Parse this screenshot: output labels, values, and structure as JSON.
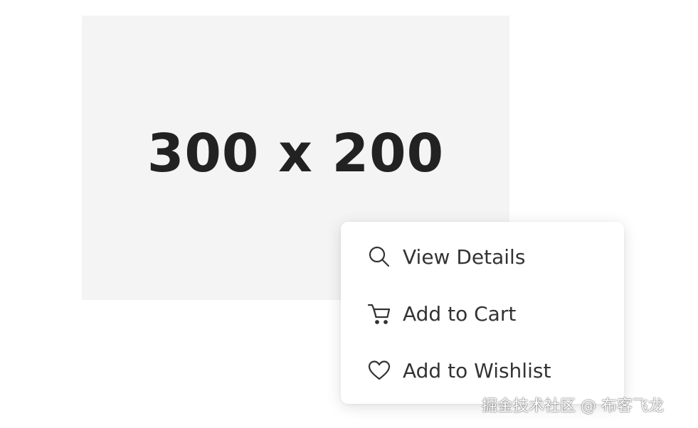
{
  "placeholder": {
    "text": "300 x 200"
  },
  "menu": {
    "items": [
      {
        "icon": "search-icon",
        "label": "View Details"
      },
      {
        "icon": "cart-icon",
        "label": "Add to Cart"
      },
      {
        "icon": "heart-icon",
        "label": "Add to Wishlist"
      }
    ]
  },
  "watermark": {
    "text": "掘金技术社区 @ 布客飞龙"
  },
  "colors": {
    "placeholder_bg": "#f4f4f4",
    "placeholder_text": "#222222",
    "menu_bg": "#ffffff",
    "menu_text": "#333333"
  }
}
